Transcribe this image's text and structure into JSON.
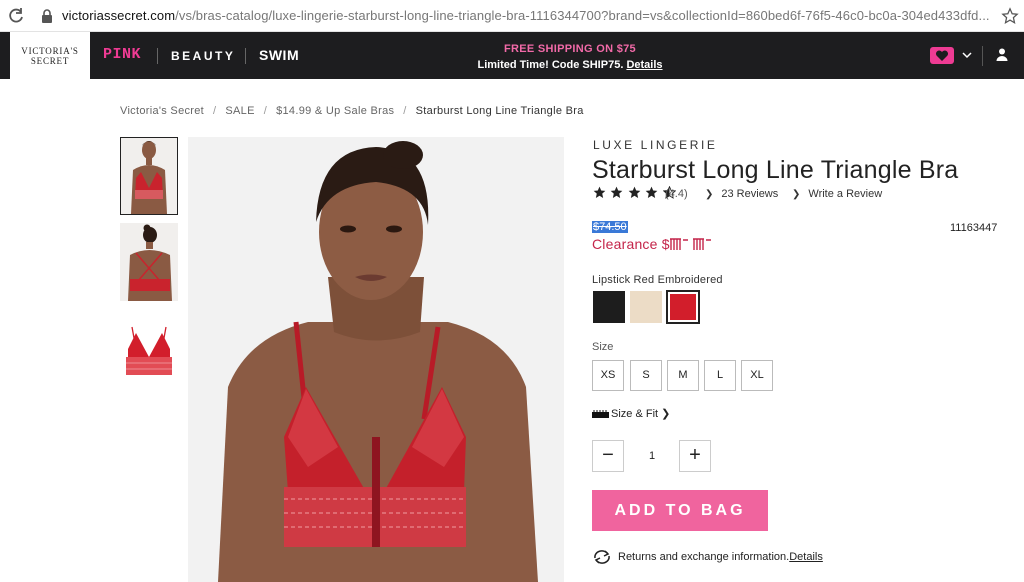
{
  "browser": {
    "url_host": "victoriassecret.com",
    "url_rest": "/vs/bras-catalog/luxe-lingerie-starburst-long-line-triangle-bra-1116344700?brand=vs&collectionId=860bed6f-76f5-46c0-bc0a-304ed433dfd..."
  },
  "nav": {
    "logo_line1": "VICTORIA'S",
    "logo_line2": "SECRET",
    "pink": "PINK",
    "beauty": "BEAUTY",
    "swim": "SWIM",
    "promo_line1": "FREE SHIPPING ON $75",
    "promo_line2": "Limited Time! Code SHIP75.",
    "promo_details": "Details"
  },
  "breadcrumb": [
    "Victoria's Secret",
    "SALE",
    "$14.99 & Up Sale Bras",
    "Starburst Long Line Triangle Bra"
  ],
  "breadcrumb_sep": "/",
  "product": {
    "brand": "LUXE LINGERIE",
    "title": "Starburst Long Line Triangle Bra",
    "rating": 4.4,
    "rating_text": "(4.4)",
    "reviews_link": "23 Reviews",
    "write_review": "Write a Review",
    "original_price": "$74.50",
    "clearance": "Clearance $",
    "sku": "11163447",
    "color_label": "Lipstick Red Embroidered",
    "swatches": [
      "#1d1d1d",
      "#ecdcc6",
      "#d21e2b"
    ],
    "size_label": "Size",
    "sizes": [
      "XS",
      "S",
      "M",
      "L",
      "XL"
    ],
    "size_fit": "Size & Fit",
    "qty_minus": "−",
    "qty_value": "1",
    "qty_plus": "+",
    "add_to_bag": "ADD TO BAG",
    "returns_text": "Returns and exchange information.",
    "returns_details": "Details"
  },
  "colors": {
    "accent_pink": "#f0649e",
    "nav_bg": "#1d1d1f",
    "clearance_red": "#c4254a"
  }
}
